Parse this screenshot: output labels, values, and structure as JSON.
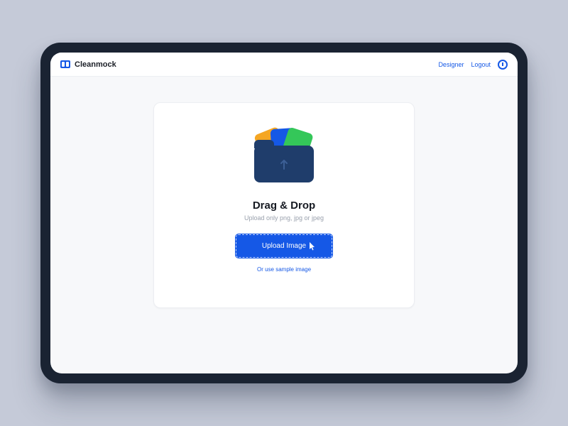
{
  "brand": {
    "name": "Cleanmock"
  },
  "nav": {
    "designer": "Designer",
    "logout": "Logout"
  },
  "dropzone": {
    "title": "Drag & Drop",
    "subtitle": "Upload only png, jpg or jpeg",
    "button": "Upload Image",
    "sample_link": "Or use sample image"
  },
  "colors": {
    "accent": "#1558e6",
    "folder": "#1f3d6b",
    "card_orange": "#f5a623",
    "card_green": "#34c759"
  }
}
